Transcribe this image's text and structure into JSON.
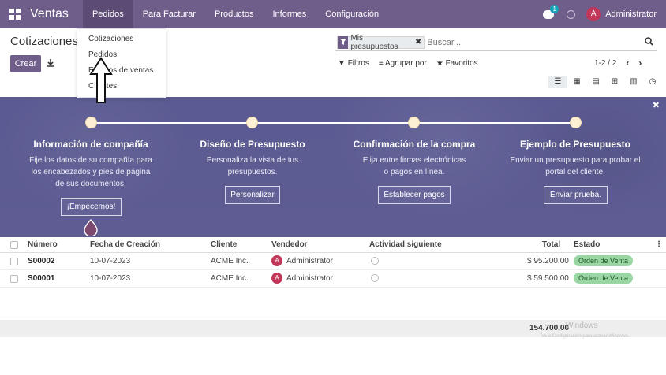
{
  "app": {
    "name": "Ventas"
  },
  "nav": {
    "items": [
      "Pedidos",
      "Para Facturar",
      "Productos",
      "Informes",
      "Configuración"
    ],
    "chat_badge": "1",
    "user_initial": "A",
    "user_name": "Administrator"
  },
  "page": {
    "title": "Cotizaciones",
    "create_label": "Crear"
  },
  "dropdown": {
    "items": [
      "Cotizaciones",
      "Pedidos",
      "Equipos de ventas",
      "Clientes"
    ]
  },
  "search": {
    "facet_label": "Mis presupuestos",
    "placeholder": "Buscar...",
    "filters_label": "Filtros",
    "group_label": "Agrupar por",
    "favorites_label": "Favoritos"
  },
  "pager": {
    "value": "1-2 / 2"
  },
  "banner": {
    "steps": [
      {
        "title": "Información de compañía",
        "desc": "Fije los datos de su compañía para los encabezados y pies de página de sus documentos.",
        "button": "¡Empecemos!"
      },
      {
        "title": "Diseño de Presupuesto",
        "desc": "Personaliza la vista de tus presupuestos.",
        "button": "Personalizar"
      },
      {
        "title": "Confirmación de la compra",
        "desc": "Elija entre firmas electrónicas o pagos en línea.",
        "button": "Establecer pagos"
      },
      {
        "title": "Ejemplo de Presupuesto",
        "desc": "Enviar un presupuesto para probar el portal del cliente.",
        "button": "Enviar prueba."
      }
    ]
  },
  "table": {
    "headers": [
      "Número",
      "Fecha de Creación",
      "Cliente",
      "Vendedor",
      "Actividad siguiente",
      "Total",
      "Estado"
    ],
    "rows": [
      {
        "number": "S00002",
        "date": "10-07-2023",
        "client": "ACME Inc.",
        "seller": "Administrator",
        "seller_initial": "A",
        "total": "$ 95.200,00",
        "status": "Orden de Venta"
      },
      {
        "number": "S00001",
        "date": "10-07-2023",
        "client": "ACME Inc.",
        "seller": "Administrator",
        "seller_initial": "A",
        "total": "$ 59.500,00",
        "status": "Orden de Venta"
      }
    ],
    "grand_total": "154.700,00"
  },
  "watermark": {
    "line1": "Windows",
    "line2": "Ve a Configuración para activar Windows."
  },
  "colors": {
    "brand": "#6f5d8a",
    "banner": "#5c5b92",
    "status_green": "#9ad6a4",
    "avatar": "#c2375a"
  }
}
